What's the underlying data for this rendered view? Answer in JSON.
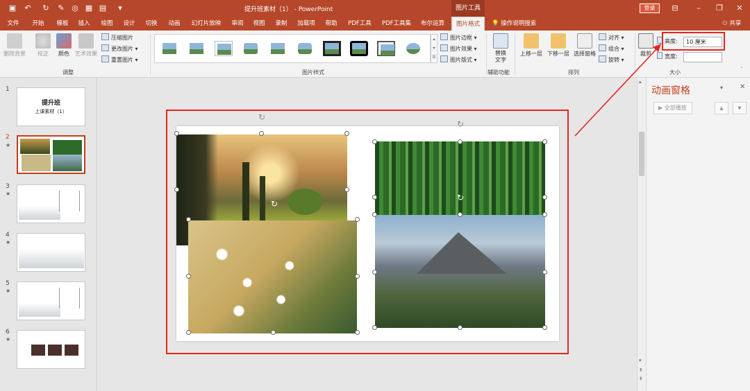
{
  "titlebar": {
    "title": "提升班素材（1） - PowerPoint",
    "context_tab": "图片工具",
    "login": "登录"
  },
  "tabs": [
    "文件",
    "开始",
    "模板",
    "插入",
    "绘图",
    "设计",
    "切换",
    "动画",
    "幻灯片放映",
    "审阅",
    "视图",
    "录制",
    "加载项",
    "帮助",
    "PDF工具",
    "PDF工具集",
    "布尔运算",
    "图片格式"
  ],
  "active_tab": "图片格式",
  "search_tab": "操作说明搜索",
  "share": "共享",
  "ribbon": {
    "adjust": {
      "remove_bg": "删除背景",
      "correct": "校正",
      "color": "颜色",
      "art_effect": "艺术效果",
      "compress": "压缩图片",
      "change": "更改图片",
      "reset": "重置图片",
      "label": "调整"
    },
    "styles": {
      "border": "图片边框",
      "effect": "图片效果",
      "layout": "图片版式",
      "label": "图片样式"
    },
    "accessibility": {
      "alt_text": "替换文字",
      "label": "辅助功能"
    },
    "arrange": {
      "bring_forward": "上移一层",
      "send_backward": "下移一层",
      "selection_pane": "选择窗格",
      "align": "对齐",
      "group": "组合",
      "rotate": "旋转",
      "label": "排列"
    },
    "size": {
      "crop": "裁剪",
      "height_label": "高度:",
      "height_value": "10 厘米",
      "width_label": "宽度:",
      "width_value": "",
      "label": "大小"
    }
  },
  "thumbnails": [
    {
      "num": "1",
      "star": "",
      "title": "提升班",
      "subtitle": "上课素材（1）"
    },
    {
      "num": "2",
      "star": "★"
    },
    {
      "num": "3",
      "star": "★"
    },
    {
      "num": "4",
      "star": "★"
    },
    {
      "num": "5",
      "star": "★"
    },
    {
      "num": "6",
      "star": "★"
    }
  ],
  "animation_pane": {
    "title": "动画窗格",
    "play_all": "全部播放"
  },
  "colors": {
    "brand": "#b7472a",
    "highlight": "#e5261c"
  }
}
